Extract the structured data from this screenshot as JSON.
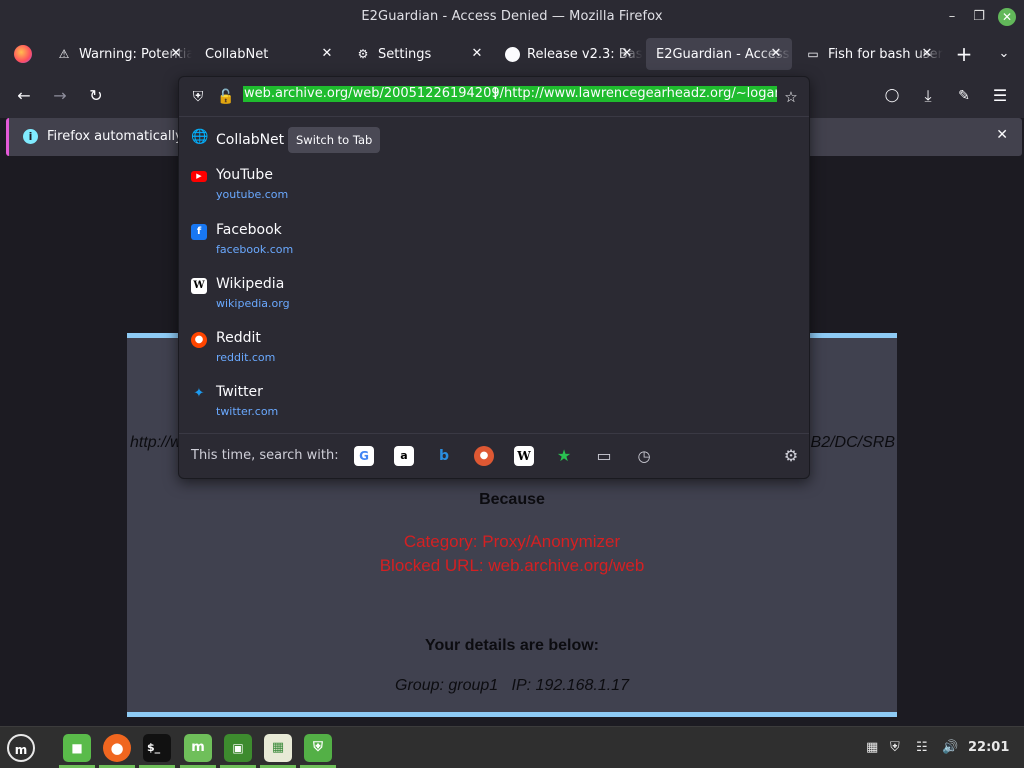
{
  "window": {
    "title": "E2Guardian - Access Denied — Mozilla Firefox"
  },
  "tabs": [
    {
      "label": "Warning: Potential Security Risk Ahead",
      "icon": "warning-icon"
    },
    {
      "label": "CollabNet",
      "icon": "none"
    },
    {
      "label": "Settings",
      "icon": "gear-icon"
    },
    {
      "label": "Release v2.3: Bash",
      "icon": "github-icon"
    },
    {
      "label": "E2Guardian - Access Denied",
      "icon": "none"
    },
    {
      "label": "Fish for bash users",
      "icon": "page-icon"
    }
  ],
  "notification": {
    "message": "Firefox automatically s"
  },
  "urlbar": {
    "value": "web.archive.org/web/20051226194209/http://www.lawrencegearheadz.org/~logan"
  },
  "suggestions": [
    {
      "name": "CollabNet",
      "url": "",
      "icon": "globe-icon",
      "action": "Switch to Tab"
    },
    {
      "name": "YouTube",
      "url": "youtube.com",
      "icon": "youtube-icon"
    },
    {
      "name": "Facebook",
      "url": "facebook.com",
      "icon": "facebook-icon"
    },
    {
      "name": "Wikipedia",
      "url": "wikipedia.org",
      "icon": "wikipedia-icon"
    },
    {
      "name": "Reddit",
      "url": "reddit.com",
      "icon": "reddit-icon"
    },
    {
      "name": "Twitter",
      "url": "twitter.com",
      "icon": "twitter-icon"
    }
  ],
  "search_with": {
    "label": "This time, search with:",
    "engines": [
      "google-icon",
      "amazon-icon",
      "bing-icon",
      "duckduckgo-icon",
      "wikipedia-icon",
      "bookmarks-icon",
      "tabs-icon",
      "history-icon"
    ]
  },
  "page": {
    "url_left": "http://w",
    "url_right": "B2/DC/SRB",
    "because": "Because",
    "category": "Category: Proxy/Anonymizer",
    "blocked_url": "Blocked URL: web.archive.org/web",
    "details_heading": "Your details are below:",
    "details": "Group: group1   IP: 192.168.1.17"
  },
  "taskbar": {
    "clock": "22:01"
  },
  "colors": {
    "accent_green": "#1fbc2e",
    "link_blue": "#6aa9ff",
    "blocked_red": "#d42022",
    "card_border": "#8ecbf5"
  }
}
